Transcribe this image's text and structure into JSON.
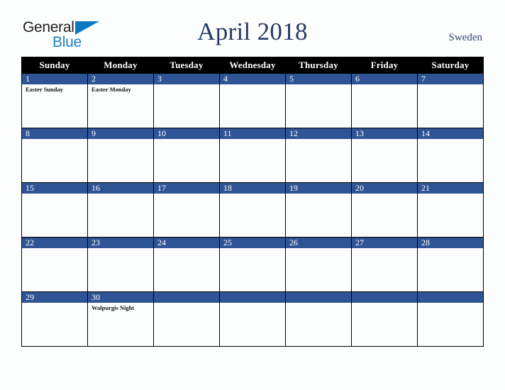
{
  "brand": {
    "line1": "General",
    "line2": "Blue",
    "triangle_color": "#0a7ac4",
    "line2_color": "#1f7fc4"
  },
  "header": {
    "month_title": "April 2018",
    "country": "Sweden",
    "title_color": "#253a64"
  },
  "calendar": {
    "header_bg": "#000000",
    "daynum_bg": "#2f5496",
    "weekdays": [
      "Sunday",
      "Monday",
      "Tuesday",
      "Wednesday",
      "Thursday",
      "Friday",
      "Saturday"
    ],
    "weeks": [
      [
        {
          "day": "1",
          "events": [
            "Easter Sunday"
          ]
        },
        {
          "day": "2",
          "events": [
            "Easter Monday"
          ]
        },
        {
          "day": "3",
          "events": []
        },
        {
          "day": "4",
          "events": []
        },
        {
          "day": "5",
          "events": []
        },
        {
          "day": "6",
          "events": []
        },
        {
          "day": "7",
          "events": []
        }
      ],
      [
        {
          "day": "8",
          "events": []
        },
        {
          "day": "9",
          "events": []
        },
        {
          "day": "10",
          "events": []
        },
        {
          "day": "11",
          "events": []
        },
        {
          "day": "12",
          "events": []
        },
        {
          "day": "13",
          "events": []
        },
        {
          "day": "14",
          "events": []
        }
      ],
      [
        {
          "day": "15",
          "events": []
        },
        {
          "day": "16",
          "events": []
        },
        {
          "day": "17",
          "events": []
        },
        {
          "day": "18",
          "events": []
        },
        {
          "day": "19",
          "events": []
        },
        {
          "day": "20",
          "events": []
        },
        {
          "day": "21",
          "events": []
        }
      ],
      [
        {
          "day": "22",
          "events": []
        },
        {
          "day": "23",
          "events": []
        },
        {
          "day": "24",
          "events": []
        },
        {
          "day": "25",
          "events": []
        },
        {
          "day": "26",
          "events": []
        },
        {
          "day": "27",
          "events": []
        },
        {
          "day": "28",
          "events": []
        }
      ],
      [
        {
          "day": "29",
          "events": []
        },
        {
          "day": "30",
          "events": [
            "Walpurgis Night"
          ]
        },
        {
          "day": "",
          "events": []
        },
        {
          "day": "",
          "events": []
        },
        {
          "day": "",
          "events": []
        },
        {
          "day": "",
          "events": []
        },
        {
          "day": "",
          "events": []
        }
      ]
    ]
  }
}
